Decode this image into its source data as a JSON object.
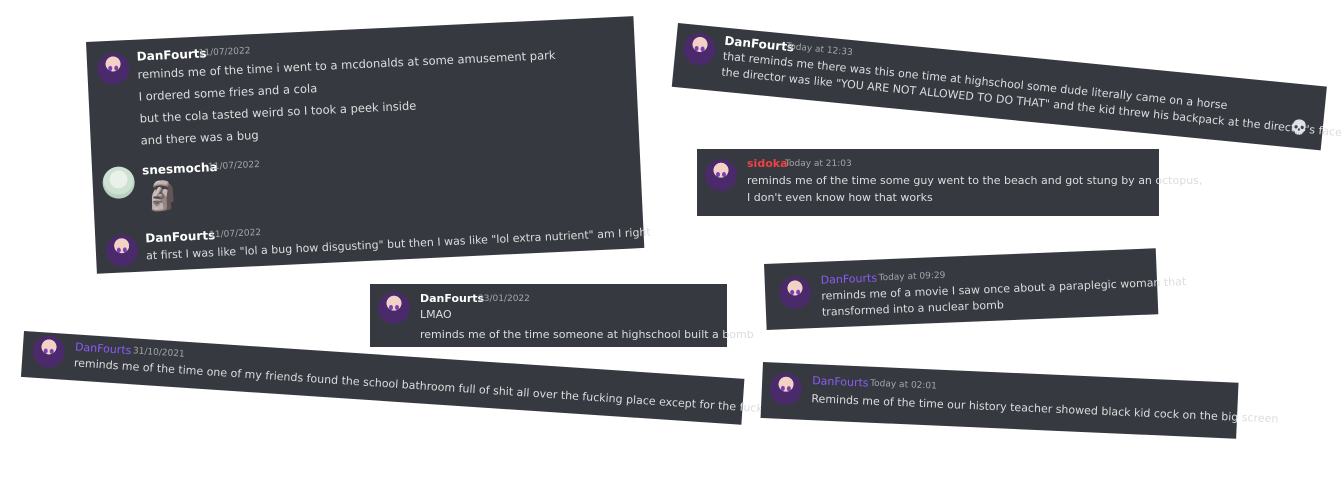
{
  "cards": [
    {
      "id": "card-mcdonalds",
      "messages": [
        {
          "author": "DanFourts",
          "timestamp": "11/07/2022",
          "lines": [
            "reminds me of the time i went to a mcdonalds at some amusement park",
            "I ordered some fries and a cola",
            "but the cola tasted weird so I took a peek inside",
            "and there was a bug"
          ]
        },
        {
          "author": "snesmocha",
          "timestamp": "11/07/2022",
          "emoji": "moai-emoji"
        },
        {
          "author": "DanFourts",
          "timestamp": "11/07/2022",
          "lines": [
            "at first I was like \"lol a bug how disgusting\" but then I was like \"lol extra nutrient\" am I right"
          ]
        }
      ]
    },
    {
      "id": "card-horse",
      "messages": [
        {
          "author": "DanFourts",
          "timestamp": "Today at 12:33",
          "lines": [
            "that reminds me there was this one time at highschool some dude literally came on a horse",
            "the director was like \"YOU ARE NOT ALLOWED TO DO THAT\" and the kid threw his backpack at the director's face"
          ],
          "trailing_emoji": "skull-emoji"
        }
      ]
    },
    {
      "id": "card-octopus",
      "messages": [
        {
          "author": "sidoka",
          "timestamp": "Today at 21:03",
          "lines": [
            "reminds me of the time some guy went to the beach and got stung by an octopus,",
            "I don't even know how that works"
          ]
        }
      ]
    },
    {
      "id": "card-movie",
      "messages": [
        {
          "author": "DanFourts",
          "timestamp": "Today at 09:29",
          "lines": [
            "reminds me of a movie I saw once about a paraplegic woman that",
            "transformed into a nuclear bomb"
          ]
        }
      ]
    },
    {
      "id": "card-bomb",
      "messages": [
        {
          "author": "DanFourts",
          "timestamp": "23/01/2022",
          "lines": [
            "LMAO",
            "reminds me of the time someone at highschool built a bomb"
          ]
        }
      ]
    },
    {
      "id": "card-bathroom",
      "messages": [
        {
          "author": "DanFourts",
          "timestamp": "31/10/2021",
          "lines": [
            "reminds me of the time one of my friends found the school bathroom full of shit all over the fucking place except for the fucking toilets"
          ]
        }
      ]
    },
    {
      "id": "card-history",
      "messages": [
        {
          "author": "DanFourts",
          "timestamp": "Today at 02:01",
          "lines": [
            "Reminds me of the time our history teacher showed black kid cock on the big screen"
          ]
        }
      ]
    }
  ]
}
